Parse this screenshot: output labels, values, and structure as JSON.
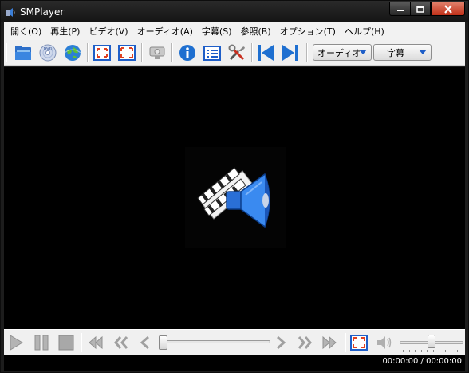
{
  "window": {
    "title": "SMPlayer",
    "accent_close": "#c8442c"
  },
  "menu": [
    {
      "label": "開く(O)",
      "name": "menu-open"
    },
    {
      "label": "再生(P)",
      "name": "menu-play"
    },
    {
      "label": "ビデオ(V)",
      "name": "menu-video"
    },
    {
      "label": "オーディオ(A)",
      "name": "menu-audio"
    },
    {
      "label": "字幕(S)",
      "name": "menu-subtitles"
    },
    {
      "label": "参照(B)",
      "name": "menu-browse"
    },
    {
      "label": "オプション(T)",
      "name": "menu-options"
    },
    {
      "label": "ヘルプ(H)",
      "name": "menu-help"
    }
  ],
  "toolbar": {
    "icons": [
      "open-folder-icon",
      "open-dvd-icon",
      "open-url-globe-icon",
      "compact-mode-icon",
      "fullscreen-icon",
      "screenshot-icon",
      "info-icon",
      "playlist-icon",
      "preferences-tools-icon",
      "previous-icon",
      "next-icon"
    ],
    "audio_combo": "オーディオ",
    "subtitle_combo": "字幕"
  },
  "controls": {
    "icons": [
      "play-icon",
      "pause-icon",
      "stop-icon",
      "rewind-long-icon",
      "rewind-medium-icon",
      "rewind-short-icon",
      "forward-short-icon",
      "forward-medium-icon",
      "forward-long-icon",
      "fullscreen-toggle-icon",
      "mute-speaker-icon"
    ],
    "seek_position": 0.0,
    "volume_level": 0.5
  },
  "status": {
    "time": "00:00:00 / 00:00:00"
  }
}
